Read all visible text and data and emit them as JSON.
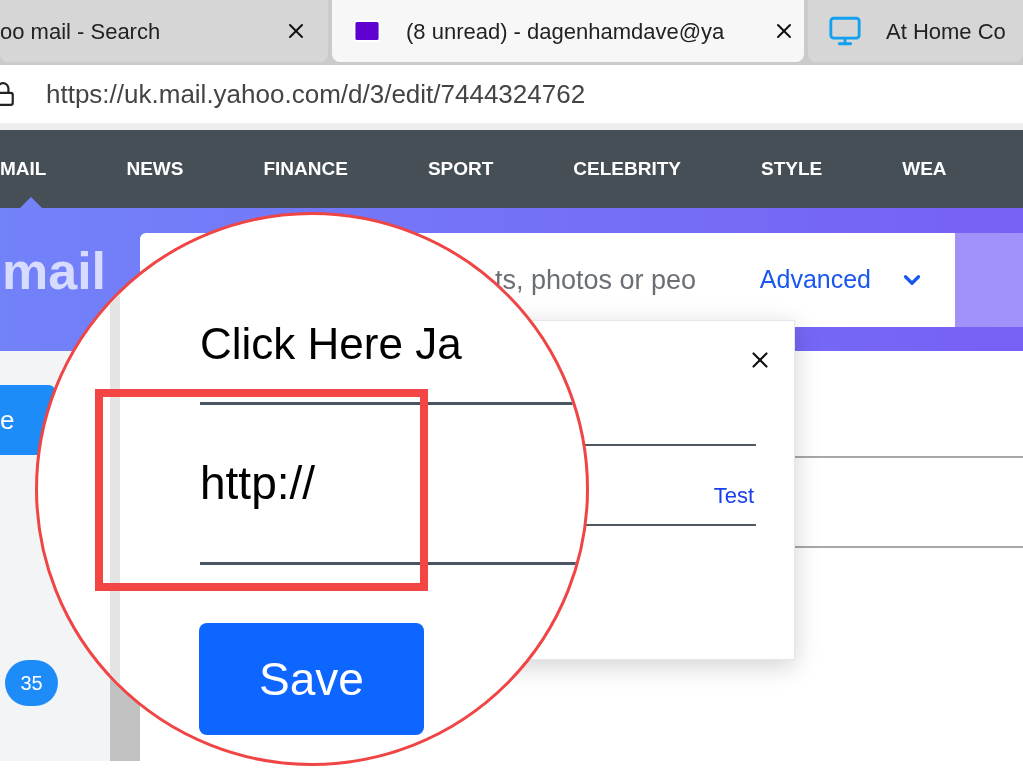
{
  "browser": {
    "tabs": [
      {
        "title": "oo mail - Search",
        "kind": "plain",
        "selected": false
      },
      {
        "title": "(8 unread) - dagenhamdave@ya",
        "kind": "mail",
        "selected": true
      },
      {
        "title": "At Home Co",
        "kind": "monitor",
        "selected": false
      }
    ],
    "url": "https://uk.mail.yahoo.com/d/3/edit/7444324762"
  },
  "nav": {
    "items": [
      {
        "label": "MAIL",
        "selected": true
      },
      {
        "label": "NEWS",
        "selected": false
      },
      {
        "label": "FINANCE",
        "selected": false
      },
      {
        "label": "SPORT",
        "selected": false
      },
      {
        "label": "CELEBRITY",
        "selected": false
      },
      {
        "label": "STYLE",
        "selected": false
      },
      {
        "label": "WEA",
        "selected": false
      }
    ]
  },
  "header": {
    "logo": "mail",
    "search_placeholder": "ts, photos or peo",
    "advanced": "Advanced"
  },
  "sidebar": {
    "compose": "e",
    "badge": "35"
  },
  "link_dialog": {
    "test_link": "Test"
  },
  "magnifier": {
    "text_value": "Click Here Ja",
    "url_value": "http://",
    "save": "Save"
  }
}
